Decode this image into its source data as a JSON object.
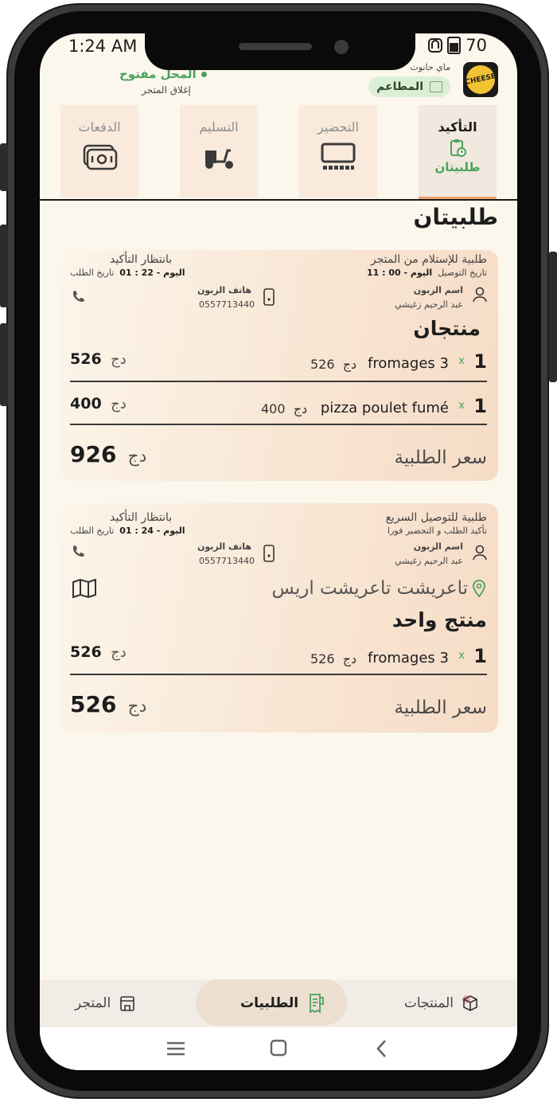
{
  "status_bar": {
    "time": "1:24 AM",
    "battery": "70"
  },
  "header": {
    "brand_line": "ماي حانوت",
    "logo_text": "CHEESE",
    "restaurants_label": "المطاعم",
    "store_status": "المحل مفتوح",
    "close_store": "إغلاق المتجر"
  },
  "tabs": [
    {
      "label": "التأكيد",
      "count": "طلبيتان",
      "active": true,
      "icon": "clipboard-clock-icon"
    },
    {
      "label": "التحضير",
      "active": false,
      "icon": "kitchen-display-icon"
    },
    {
      "label": "التسليم",
      "active": false,
      "icon": "scooter-icon"
    },
    {
      "label": "الدفعات",
      "active": false,
      "icon": "cash-icon"
    }
  ],
  "section_title": "طلبيتان",
  "orders": [
    {
      "type": "طلبية للإستلام من المتجر",
      "time_label": "تاريخ التوصيل",
      "time_value": "اليوم - 00 : 11",
      "status": "بانتظار التأكيد",
      "order_date_label": "تاريخ الطلب",
      "order_date_value": "اليوم - 22 : 01",
      "customer_name_label": "اسم الزبون",
      "customer_name": "عبد الرحيم زغيشي",
      "phone_label": "هاتف الزبون",
      "phone": "0557713440",
      "products_count": "منتجان",
      "items": [
        {
          "qty": "1",
          "times": "x",
          "name": "fromages 3",
          "unit_price": "526",
          "currency": "دج",
          "total": "526"
        },
        {
          "qty": "1",
          "times": "x",
          "name": "pizza poulet fumé",
          "unit_price": "400",
          "currency": "دج",
          "total": "400"
        }
      ],
      "total_label": "سعر الطلبية",
      "total": "926",
      "currency": "دج"
    },
    {
      "type": "طلبية للتوصيل السريع",
      "time_label": "تأكيد الطلب و التحضير فورا",
      "time_value": "",
      "status": "بانتظار التأكيد",
      "order_date_label": "تاريخ الطلب",
      "order_date_value": "اليوم - 24 : 01",
      "customer_name_label": "اسم الزبون",
      "customer_name": "عبد الرحيم زغيشي",
      "phone_label": "هاتف الزبون",
      "phone": "0557713440",
      "address": "تاعريشت تاعريشت اريس",
      "products_count": "منتج واحد",
      "items": [
        {
          "qty": "1",
          "times": "x",
          "name": "fromages 3",
          "unit_price": "526",
          "currency": "دج",
          "total": "526"
        }
      ],
      "total_label": "سعر الطلبية",
      "total": "526",
      "currency": "دج"
    }
  ],
  "bottom_nav": {
    "store": "المتجر",
    "orders": "الطلبيات",
    "products": "المنتجات"
  },
  "colors": {
    "accent_green": "#4aa35c",
    "tab_underline": "#f0a36e",
    "background": "#fcf7ed"
  }
}
